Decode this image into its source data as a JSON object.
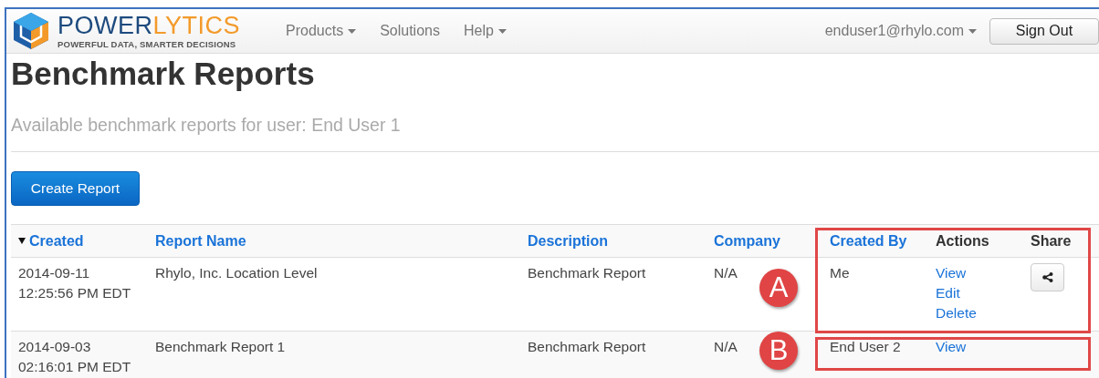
{
  "brand": {
    "name_first": "POWER",
    "name_second": "LYTICS",
    "tagline": "POWERFUL DATA, SMARTER DECISIONS"
  },
  "nav": [
    {
      "label": "Products",
      "dropdown": true
    },
    {
      "label": "Solutions",
      "dropdown": false
    },
    {
      "label": "Help",
      "dropdown": true
    }
  ],
  "user_menu": {
    "label": "enduser1@rhylo.com",
    "dropdown": true
  },
  "sign_out": "Sign Out",
  "page": {
    "title": "Benchmark Reports",
    "subtitle": "Available benchmark reports for user: End User 1"
  },
  "create_button": "Create Report",
  "table": {
    "columns": [
      {
        "label": "Created",
        "kind": "link",
        "sorted": true
      },
      {
        "label": "Report Name",
        "kind": "link"
      },
      {
        "label": "Description",
        "kind": "link"
      },
      {
        "label": "Company",
        "kind": "link"
      },
      {
        "label": "Created By",
        "kind": "link"
      },
      {
        "label": "Actions",
        "kind": "plain"
      },
      {
        "label": "Share",
        "kind": "plain"
      }
    ],
    "rows": [
      {
        "created_date": "2014-09-11",
        "created_time": "12:25:56 PM EDT",
        "report_name": "Rhylo, Inc. Location Level",
        "description": "Benchmark Report",
        "company": "N/A",
        "created_by": "Me",
        "actions": [
          "View",
          "Edit",
          "Delete"
        ],
        "share": true
      },
      {
        "created_date": "2014-09-03",
        "created_time": "02:16:01 PM EDT",
        "report_name": "Benchmark Report 1",
        "description": "Benchmark Report",
        "company": "N/A",
        "created_by": "End User 2",
        "actions": [
          "View"
        ],
        "share": false
      }
    ]
  },
  "annotations": [
    {
      "label": "A"
    },
    {
      "label": "B"
    }
  ]
}
